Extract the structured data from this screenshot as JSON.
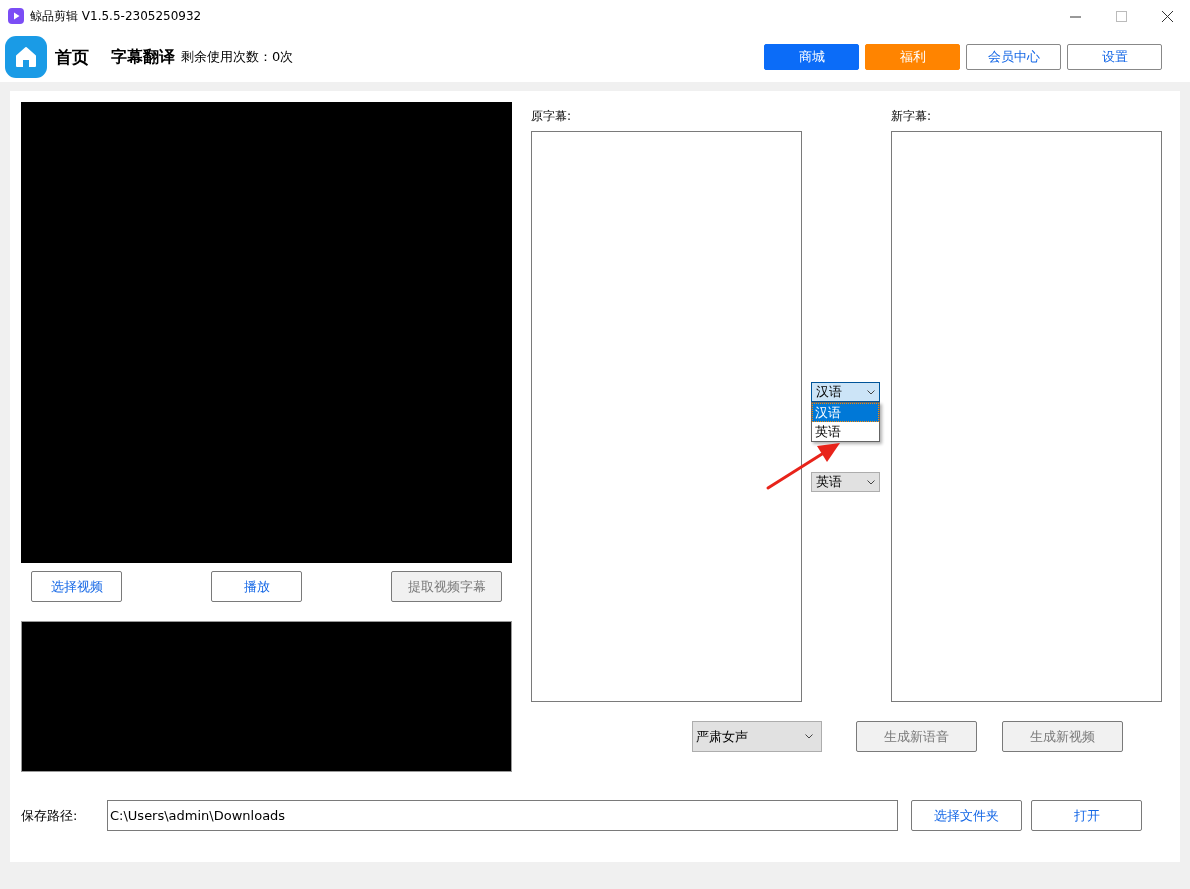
{
  "window": {
    "title": "鲸品剪辑 V1.5.5-2305250932"
  },
  "header": {
    "home_label": "首页",
    "page_title": "字幕翻译",
    "usage_text": "剩余使用次数：0次",
    "buttons": [
      {
        "label": "商城",
        "kind": "primary"
      },
      {
        "label": "福利",
        "kind": "accent"
      },
      {
        "label": "会员中心",
        "kind": "outline"
      },
      {
        "label": "设置",
        "kind": "outline"
      }
    ]
  },
  "video_buttons": [
    {
      "label": "选择视频",
      "disabled": false
    },
    {
      "label": "播放",
      "disabled": false
    },
    {
      "label": "提取视频字幕",
      "disabled": true
    }
  ],
  "original_subtitles": {
    "label": "原字幕:"
  },
  "new_subtitles": {
    "label": "新字幕:"
  },
  "source_language": {
    "value": "汉语",
    "expanded": true,
    "options": [
      {
        "label": "汉语",
        "selected": true
      },
      {
        "label": "英语",
        "selected": false
      }
    ]
  },
  "target_language": {
    "value": "英语"
  },
  "voice": {
    "value": "严肃女声"
  },
  "generate_buttons": [
    {
      "label": "生成新语音",
      "disabled": true
    },
    {
      "label": "生成新视频",
      "disabled": true
    }
  ],
  "save_path": {
    "label": "保存路径:",
    "value": "C:\\Users\\admin\\Downloads"
  },
  "path_buttons": [
    {
      "label": "选择文件夹",
      "disabled": false
    },
    {
      "label": "打开",
      "disabled": false
    }
  ]
}
